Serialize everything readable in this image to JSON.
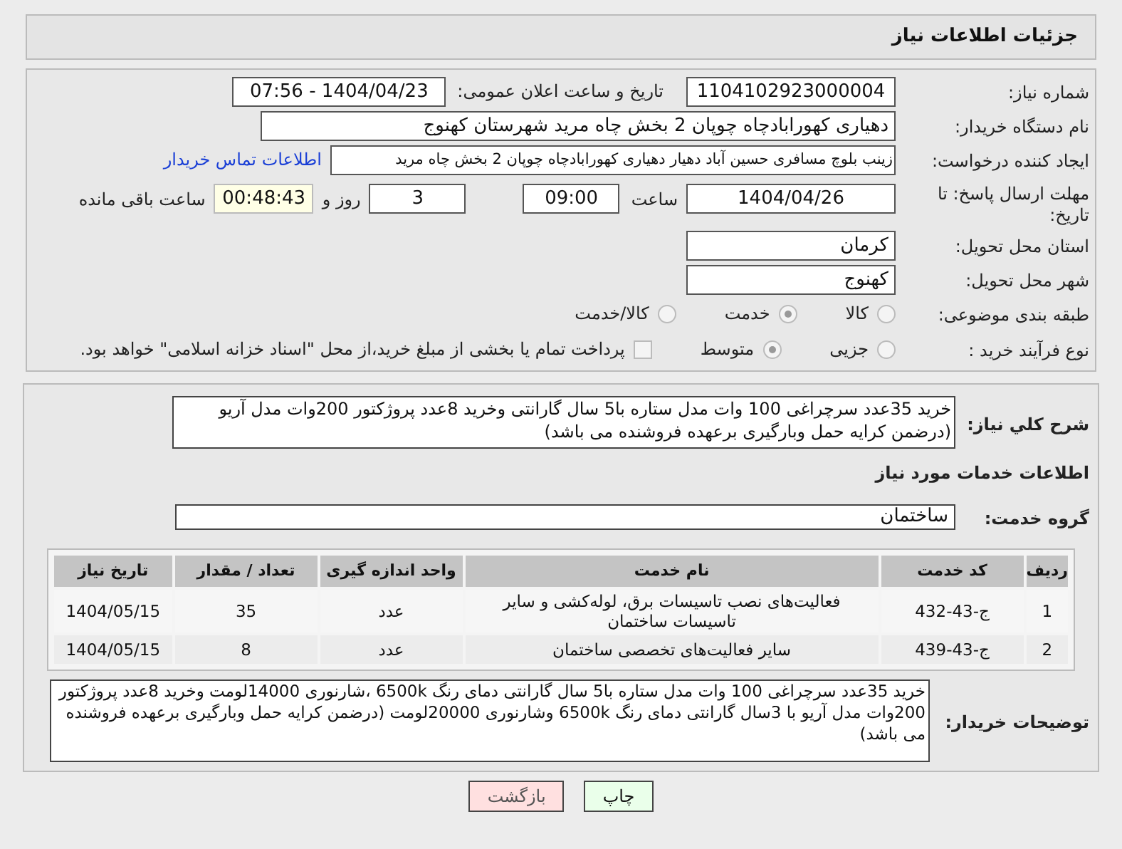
{
  "header": {
    "title": "جزئیات اطلاعات نیاز"
  },
  "need_number": {
    "label": "شماره نیاز:",
    "value": "1104102923000004"
  },
  "announce": {
    "label": "تاریخ و ساعت اعلان عمومی:",
    "value": "1404/04/23 - 07:56"
  },
  "buyer_org": {
    "label": "نام دستگاه خریدار:",
    "value": "دهیاری کهورابادچاه چوپان 2 بخش چاه مرید شهرستان کهنوج"
  },
  "requester": {
    "label": "ایجاد کننده درخواست:",
    "value": "زینب بلوچ مسافری حسین آباد دهیار دهیاری کهورابادچاه چوپان 2 بخش چاه مرید",
    "link": "اطلاعات تماس خریدار"
  },
  "deadline": {
    "label": "مهلت ارسال پاسخ: تا تاریخ:",
    "date": "1404/04/26",
    "time_label": "ساعت",
    "time": "09:00",
    "days": "3",
    "days_label": "روز و",
    "remaining": "00:48:43",
    "remaining_label": "ساعت باقی مانده"
  },
  "province": {
    "label": "استان محل تحویل:",
    "value": "کرمان"
  },
  "city": {
    "label": "شهر محل تحویل:",
    "value": "کهنوج"
  },
  "category": {
    "label": "طبقه بندی موضوعی:",
    "options": [
      {
        "label": "کالا",
        "selected": false
      },
      {
        "label": "خدمت",
        "selected": true
      },
      {
        "label": "کالا/خدمت",
        "selected": false
      }
    ]
  },
  "purchase_type": {
    "label": "نوع فرآیند خرید :",
    "options": [
      {
        "label": "جزیی",
        "selected": false
      },
      {
        "label": "متوسط",
        "selected": true
      }
    ],
    "payment": {
      "checked": false,
      "text": "پرداخت تمام یا بخشی از مبلغ خرید،از محل \"اسناد خزانه اسلامی\" خواهد بود."
    }
  },
  "summary": {
    "label": "شرح کلي نياز:",
    "value": "خرید 35عدد سرچراغی 100 وات مدل ستاره با5 سال گارانتی وخرید 8عدد پروژکتور 200وات مدل آریو  (درضمن کرایه حمل وبارگیری برعهده فروشنده می باشد)"
  },
  "services_heading": "اطلاعات خدمات مورد نیاز",
  "service_group": {
    "label": "گروه خدمت:",
    "value": "ساختمان"
  },
  "table": {
    "columns": [
      "ردیف",
      "کد خدمت",
      "نام خدمت",
      "واحد اندازه گیری",
      "تعداد / مقدار",
      "تاریخ نیاز"
    ],
    "rows": [
      [
        "1",
        "ج-43-432",
        "فعالیت‌های نصب تاسیسات برق، لوله‌کشی و سایر تاسیسات ساختمان",
        "عدد",
        "35",
        "1404/05/15"
      ],
      [
        "2",
        "ج-43-439",
        "سایر فعالیت‌های تخصصی ساختمان",
        "عدد",
        "8",
        "1404/05/15"
      ]
    ]
  },
  "buyer_notes": {
    "label": "توضیحات خریدار:",
    "value": "خرید 35عدد سرچراغی 100 وات مدل ستاره با5 سال گارانتی دمای رنگ 6500k ،شارنوری 14000لومت وخرید 8عدد پروژکتور 200وات مدل آریو با 3سال گارانتی دمای رنگ 6500k وشارنوری 20000لومت (درضمن کرایه حمل وبارگیری برعهده فروشنده می باشد)"
  },
  "buttons": [
    {
      "label": "چاپ",
      "kind": "print"
    },
    {
      "label": "بازگشت",
      "kind": "back"
    }
  ]
}
